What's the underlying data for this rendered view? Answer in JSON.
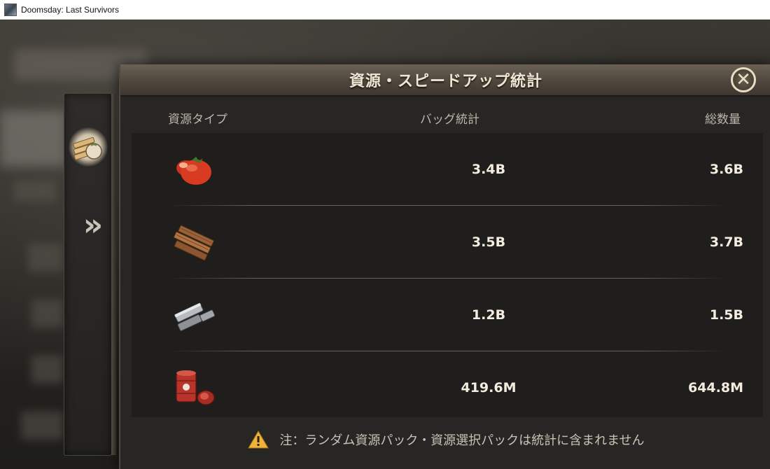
{
  "window": {
    "title": "Doomsday: Last Survivors"
  },
  "dialog": {
    "title": "資源・スピードアップ統計",
    "close_icon": "close-x-icon"
  },
  "side_tabs": [
    {
      "icon": "resource-crate-icon",
      "selected": true
    },
    {
      "icon": "speedup-chevron-icon",
      "glyph": "»",
      "selected": false
    }
  ],
  "table": {
    "headers": {
      "type": "資源タイプ",
      "bag": "バッグ統計",
      "total": "総数量"
    },
    "rows": [
      {
        "icon": "tomato-food-icon",
        "bag": "3.4B",
        "total": "3.6B"
      },
      {
        "icon": "wood-planks-icon",
        "bag": "3.5B",
        "total": "3.7B"
      },
      {
        "icon": "steel-ingots-icon",
        "bag": "1.2B",
        "total": "1.5B"
      },
      {
        "icon": "oil-barrels-icon",
        "bag": "419.6M",
        "total": "644.8M"
      }
    ]
  },
  "note": {
    "icon": "warning-triangle-icon",
    "text": "注：ランダム資源パック・資源選択パックは統計に含まれません"
  },
  "colors": {
    "accent": "#f0e6d2",
    "panel": "#282624",
    "warning": "#f2b33a"
  }
}
